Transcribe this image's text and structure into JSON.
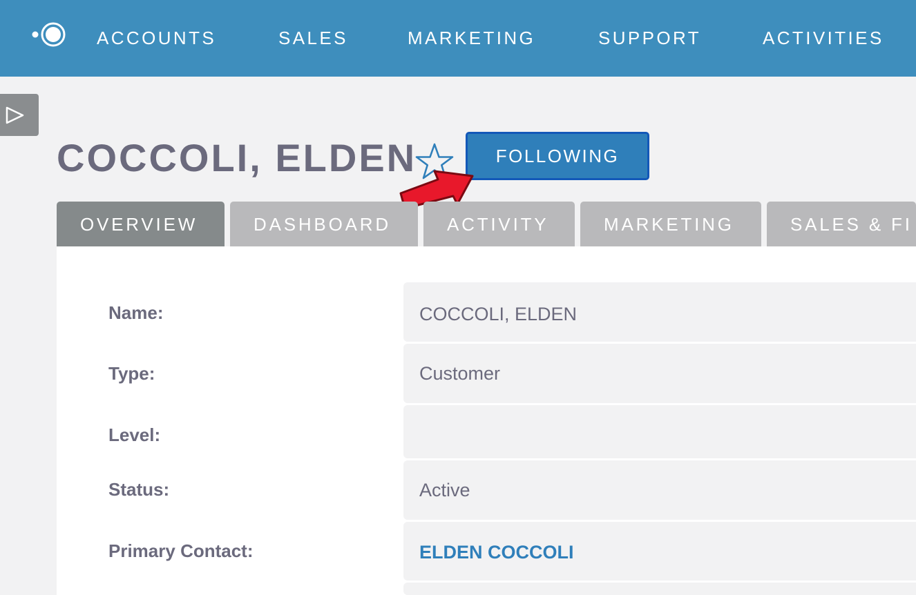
{
  "nav": {
    "items": [
      "ACCOUNTS",
      "SALES",
      "MARKETING",
      "SUPPORT",
      "ACTIVITIES"
    ]
  },
  "record": {
    "title": "COCCOLI, ELDEN",
    "follow_label": "FOLLOWING"
  },
  "tabs": [
    {
      "label": "OVERVIEW",
      "active": true
    },
    {
      "label": "DASHBOARD",
      "active": false
    },
    {
      "label": "ACTIVITY",
      "active": false
    },
    {
      "label": "MARKETING",
      "active": false
    },
    {
      "label": "SALES & FI",
      "active": false
    }
  ],
  "fields": [
    {
      "label": "Name:",
      "value": "COCCOLI, ELDEN"
    },
    {
      "label": "Type:",
      "value": "Customer"
    },
    {
      "label": "Level:",
      "value": ""
    },
    {
      "label": "Status:",
      "value": "Active"
    },
    {
      "label": "Primary Contact:",
      "value": "ELDEN COCCOLI",
      "link": true
    }
  ],
  "icons": {
    "logo": "circle-logo-icon",
    "sidebar_toggle": "play-triangle-icon",
    "favorite": "star-outline-icon",
    "annotation": "red-arrow-icon"
  },
  "colors": {
    "nav_bg": "#3e8ebd",
    "button_bg": "#2f7fba",
    "button_border": "#1358b8",
    "active_tab": "#858a8b",
    "inactive_tab": "#b9b9bb",
    "text": "#6b6a7d",
    "link": "#2f7fba",
    "arrow": "#e8182b"
  }
}
